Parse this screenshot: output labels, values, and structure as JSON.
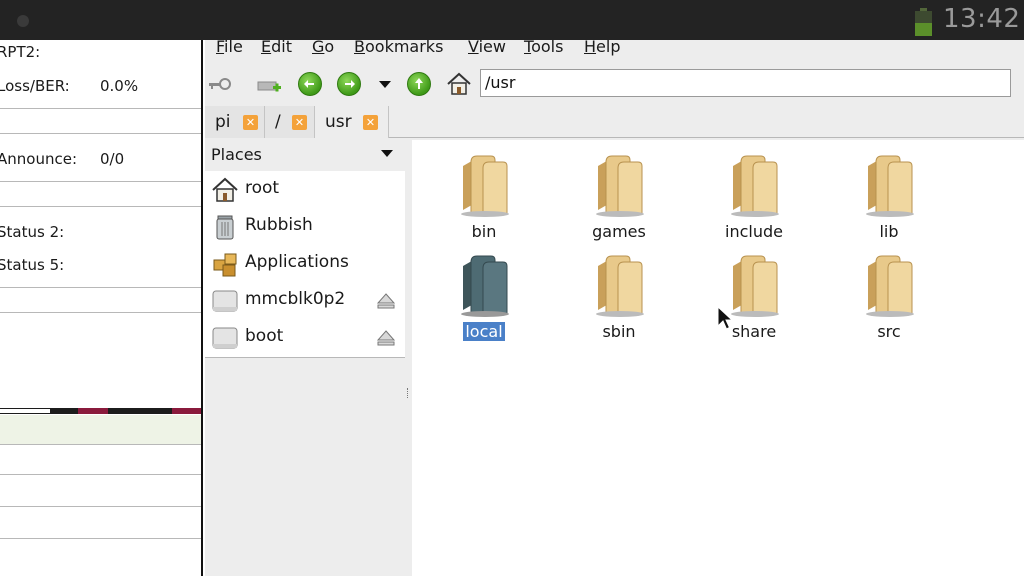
{
  "statusbar": {
    "clock": "13:42"
  },
  "left_panel": {
    "rows": [
      {
        "label": "RPT2:",
        "value": ""
      },
      {
        "label": "Loss/BER:",
        "value": "0.0%"
      },
      {
        "label": "Announce:",
        "value": "0/0"
      },
      {
        "label": "Status 2:",
        "value": ""
      },
      {
        "label": "Status 5:",
        "value": ""
      }
    ]
  },
  "menubar": {
    "items": [
      {
        "first": "F",
        "rest": "ile"
      },
      {
        "first": "E",
        "rest": "dit"
      },
      {
        "first": "G",
        "rest": "o"
      },
      {
        "first": "B",
        "rest": "ookmarks"
      },
      {
        "first": "V",
        "rest": "iew"
      },
      {
        "first": "T",
        "rest": "ools"
      },
      {
        "first": "H",
        "rest": "elp"
      }
    ]
  },
  "toolbar": {
    "address": "/usr"
  },
  "tabs": [
    {
      "label": "pi"
    },
    {
      "label": "/"
    },
    {
      "label": "usr"
    }
  ],
  "places": {
    "header": "Places",
    "items": [
      {
        "label": "root",
        "icon": "home-icon"
      },
      {
        "label": "Rubbish",
        "icon": "trash-icon"
      },
      {
        "label": "Applications",
        "icon": "applications-icon"
      },
      {
        "label": "mmcblk0p2",
        "icon": "drive-icon"
      },
      {
        "label": "boot",
        "icon": "drive-icon"
      }
    ]
  },
  "files": [
    {
      "name": "bin"
    },
    {
      "name": "games"
    },
    {
      "name": "include"
    },
    {
      "name": "lib"
    },
    {
      "name": "local",
      "selected": true
    },
    {
      "name": "sbin"
    },
    {
      "name": "share"
    },
    {
      "name": "src"
    }
  ],
  "colors": {
    "folder": "#e8c98a",
    "folder_selected": "#4e6b73",
    "selection": "#4a80c8",
    "tab_close": "#f4a23a",
    "nav_arrow": "#4fb020"
  }
}
